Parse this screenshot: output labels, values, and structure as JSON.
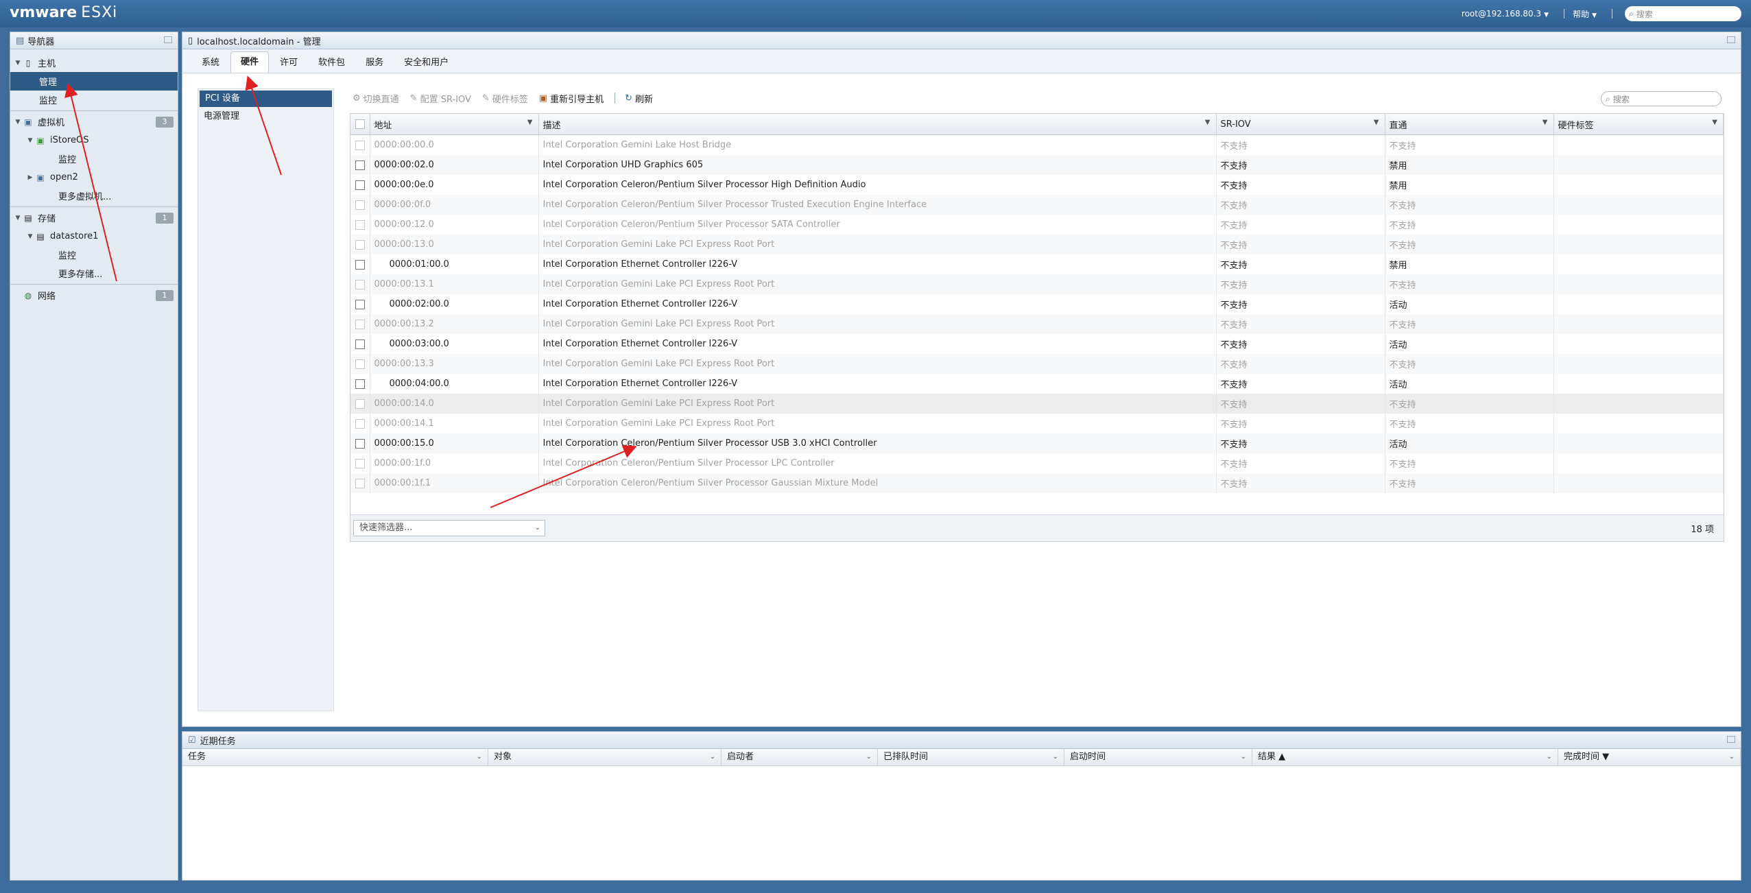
{
  "topbar": {
    "logo_vm": "vmware",
    "logo_product": "ESXi",
    "user": "root@192.168.80.3",
    "help": "帮助",
    "search_placeholder": "搜索"
  },
  "navigator": {
    "title": "导航器",
    "items": [
      {
        "label": "主机",
        "icon": "host-icon"
      },
      {
        "label": "管理"
      },
      {
        "label": "监控"
      },
      {
        "label": "虚拟机",
        "badge": "3",
        "icon": "vm-icon"
      },
      {
        "label": "iStoreOS",
        "icon": "vm-on-icon"
      },
      {
        "label": "监控"
      },
      {
        "label": "open2",
        "icon": "vm-icon"
      },
      {
        "label": "更多虚拟机..."
      },
      {
        "label": "存储",
        "badge": "1",
        "icon": "storage-icon"
      },
      {
        "label": "datastore1",
        "icon": "datastore-icon"
      },
      {
        "label": "监控"
      },
      {
        "label": "更多存储..."
      },
      {
        "label": "网络",
        "badge": "1",
        "icon": "network-icon"
      }
    ]
  },
  "main": {
    "title": "localhost.localdomain - 管理",
    "tabs": [
      "系统",
      "硬件",
      "许可",
      "软件包",
      "服务",
      "安全和用户"
    ],
    "subnav": [
      "PCI 设备",
      "电源管理"
    ],
    "toolbar": [
      "切换直通",
      "配置 SR-IOV",
      "硬件标签",
      "重新引导主机",
      "刷新"
    ],
    "search_placeholder": "搜索",
    "columns": [
      "地址",
      "描述",
      "SR-IOV",
      "直通",
      "硬件标签"
    ],
    "rows": [
      {
        "addr": "0000:00:00.0",
        "desc": "Intel Corporation Gemini Lake Host Bridge",
        "sriov": "不支持",
        "pt": "不支持",
        "dim": true
      },
      {
        "addr": "0000:00:02.0",
        "desc": "Intel Corporation UHD Graphics 605",
        "sriov": "不支持",
        "pt": "禁用",
        "dim": false
      },
      {
        "addr": "0000:00:0e.0",
        "desc": "Intel Corporation Celeron/Pentium Silver Processor High Definition Audio",
        "sriov": "不支持",
        "pt": "禁用",
        "dim": false
      },
      {
        "addr": "0000:00:0f.0",
        "desc": "Intel Corporation Celeron/Pentium Silver Processor Trusted Execution Engine Interface",
        "sriov": "不支持",
        "pt": "不支持",
        "dim": true
      },
      {
        "addr": "0000:00:12.0",
        "desc": "Intel Corporation Celeron/Pentium Silver Processor SATA Controller",
        "sriov": "不支持",
        "pt": "不支持",
        "dim": true
      },
      {
        "addr": "0000:00:13.0",
        "desc": "Intel Corporation Gemini Lake PCI Express Root Port",
        "sriov": "不支持",
        "pt": "不支持",
        "dim": true
      },
      {
        "addr": "0000:01:00.0",
        "desc": "Intel Corporation Ethernet Controller I226-V",
        "sriov": "不支持",
        "pt": "禁用",
        "dim": false,
        "indent": true
      },
      {
        "addr": "0000:00:13.1",
        "desc": "Intel Corporation Gemini Lake PCI Express Root Port",
        "sriov": "不支持",
        "pt": "不支持",
        "dim": true
      },
      {
        "addr": "0000:02:00.0",
        "desc": "Intel Corporation Ethernet Controller I226-V",
        "sriov": "不支持",
        "pt": "活动",
        "dim": false,
        "indent": true
      },
      {
        "addr": "0000:00:13.2",
        "desc": "Intel Corporation Gemini Lake PCI Express Root Port",
        "sriov": "不支持",
        "pt": "不支持",
        "dim": true
      },
      {
        "addr": "0000:03:00.0",
        "desc": "Intel Corporation Ethernet Controller I226-V",
        "sriov": "不支持",
        "pt": "活动",
        "dim": false,
        "indent": true
      },
      {
        "addr": "0000:00:13.3",
        "desc": "Intel Corporation Gemini Lake PCI Express Root Port",
        "sriov": "不支持",
        "pt": "不支持",
        "dim": true
      },
      {
        "addr": "0000:04:00.0",
        "desc": "Intel Corporation Ethernet Controller I226-V",
        "sriov": "不支持",
        "pt": "活动",
        "dim": false,
        "indent": true
      },
      {
        "addr": "0000:00:14.0",
        "desc": "Intel Corporation Gemini Lake PCI Express Root Port",
        "sriov": "不支持",
        "pt": "不支持",
        "dim": true,
        "hl": true
      },
      {
        "addr": "0000:00:14.1",
        "desc": "Intel Corporation Gemini Lake PCI Express Root Port",
        "sriov": "不支持",
        "pt": "不支持",
        "dim": true
      },
      {
        "addr": "0000:00:15.0",
        "desc": "Intel Corporation Celeron/Pentium Silver Processor USB 3.0 xHCI Controller",
        "sriov": "不支持",
        "pt": "活动",
        "dim": false
      },
      {
        "addr": "0000:00:1f.0",
        "desc": "Intel Corporation Celeron/Pentium Silver Processor LPC Controller",
        "sriov": "不支持",
        "pt": "不支持",
        "dim": true
      },
      {
        "addr": "0000:00:1f.1",
        "desc": "Intel Corporation Celeron/Pentium Silver Processor Gaussian Mixture Model",
        "sriov": "不支持",
        "pt": "不支持",
        "dim": true
      }
    ],
    "quick_filter": "快速筛选器...",
    "count": "18 项"
  },
  "tasks": {
    "title": "近期任务",
    "columns": [
      "任务",
      "对象",
      "启动者",
      "已排队时间",
      "启动时间",
      "结果 ▲",
      "完成时间 ▼"
    ]
  },
  "colors": {
    "accent": "#2e5a87",
    "annotation_arrow": "#e02020"
  }
}
